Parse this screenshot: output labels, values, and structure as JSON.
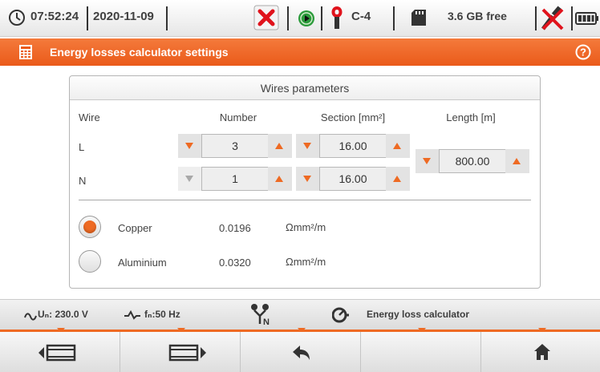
{
  "status_bar": {
    "time": "07:52:24",
    "date": "2020-11-09",
    "clamp_label": "C-4",
    "memory": "3.6 GB free",
    "icons": [
      "clock-icon",
      "error-x-icon",
      "recording-play-icon",
      "current-clamp-icon",
      "sd-card-icon",
      "usb-disconnected-icon",
      "battery-icon"
    ]
  },
  "title_bar": {
    "title": "Energy losses calculator settings",
    "icons": [
      "calculator-icon",
      "help-icon"
    ]
  },
  "panel": {
    "header": "Wires parameters",
    "columns": {
      "wire": "Wire",
      "number": "Number",
      "section": "Section [mm²]",
      "length": "Length [m]"
    },
    "rows": [
      {
        "wire": "L",
        "number": "3",
        "section": "16.00"
      },
      {
        "wire": "N",
        "number": "1",
        "section": "16.00"
      }
    ],
    "length": "800.00",
    "materials": [
      {
        "name": "Copper",
        "value": "0.0196",
        "unit": "Ωmm²/m",
        "selected": true
      },
      {
        "name": "Aluminium",
        "value": "0.0320",
        "unit": "Ωmm²/m",
        "selected": false
      }
    ]
  },
  "info_bar": {
    "voltage": "Uₙ: 230.0 V",
    "frequency": "fₙ:50 Hz",
    "mode": "Energy loss calculator",
    "icons": [
      "ac-wave-icon",
      "frequency-icon",
      "network-topology-icon",
      "meter-icon"
    ]
  },
  "bottom_buttons": [
    "screen-left-icon",
    "screen-right-icon",
    "back-arrow-icon",
    "empty",
    "home-icon"
  ],
  "colors": {
    "accent": "#ee6a23",
    "error": "#e0131c",
    "ok": "#2a9a3a"
  }
}
